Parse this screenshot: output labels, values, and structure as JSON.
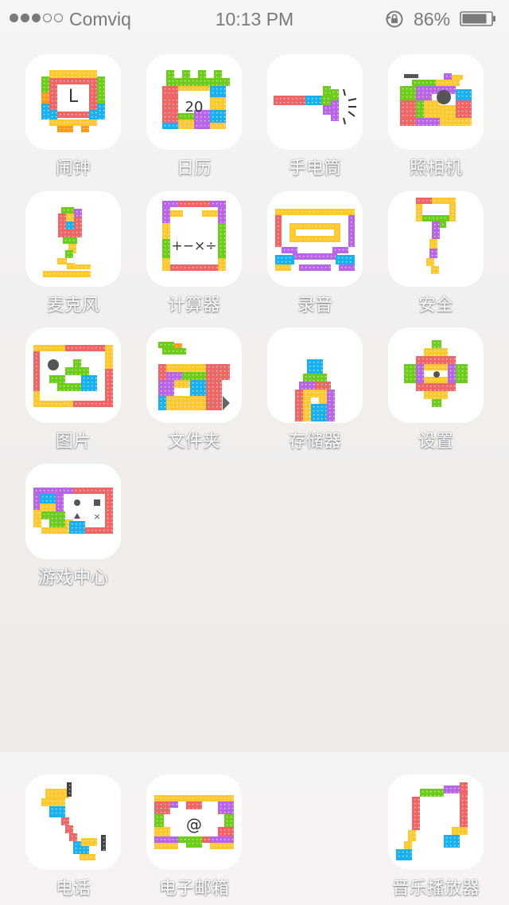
{
  "status_bar": {
    "carrier": "Comviq",
    "time": "10:13 PM",
    "battery_percent": "86%",
    "signal_bars_filled": 3,
    "signal_bars_total": 5
  },
  "apps": [
    {
      "id": "alarm",
      "label": "闹钟"
    },
    {
      "id": "calendar",
      "label": "日历",
      "icon_text": "20"
    },
    {
      "id": "flashlight",
      "label": "手电筒"
    },
    {
      "id": "camera",
      "label": "照相机"
    },
    {
      "id": "microphone",
      "label": "麦克风"
    },
    {
      "id": "calculator",
      "label": "计算器",
      "icon_text": "+−×÷"
    },
    {
      "id": "recorder",
      "label": "录音"
    },
    {
      "id": "security",
      "label": "安全"
    },
    {
      "id": "pictures",
      "label": "图片"
    },
    {
      "id": "files",
      "label": "文件夹"
    },
    {
      "id": "storage",
      "label": "存储器"
    },
    {
      "id": "settings",
      "label": "设置"
    },
    {
      "id": "game-center",
      "label": "游戏中心"
    }
  ],
  "dock": [
    {
      "id": "phone",
      "label": "电话"
    },
    {
      "id": "email",
      "label": "电子邮箱",
      "icon_text": "@"
    },
    {
      "id": "music",
      "label": "音乐播放器"
    }
  ],
  "colors": {
    "red": "#f06565",
    "yellow": "#fdc92f",
    "green": "#6ccd1a",
    "blue": "#1ab1f1",
    "purple": "#b865e8",
    "orange": "#fc9a1b"
  }
}
